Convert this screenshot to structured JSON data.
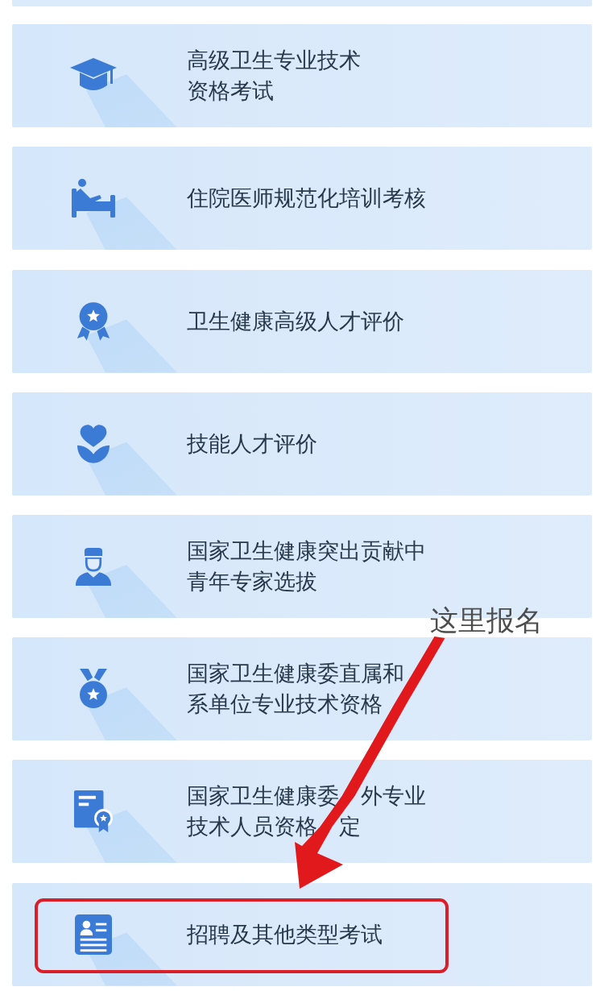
{
  "menu_items": [
    {
      "lines": [
        [
          "高级卫生专业技术"
        ],
        [
          "资格考试"
        ]
      ],
      "highlighted": false
    },
    {
      "lines": [
        [
          "住院医师规范化培训考核"
        ]
      ],
      "highlighted": false
    },
    {
      "lines": [
        [
          "卫生健康高级人才评价"
        ]
      ],
      "highlighted": false
    },
    {
      "lines": [
        [
          "技能人才评价"
        ]
      ],
      "highlighted": false
    },
    {
      "lines": [
        [
          "国家卫生健康突出贡献中"
        ],
        [
          "青年专家选拔"
        ]
      ],
      "highlighted": false
    },
    {
      "lines": [
        [
          "国家卫生健康委直属和"
        ],
        [
          "系单位专业技术资格"
        ]
      ],
      "highlighted": false
    },
    {
      "lines": [
        [
          "国家卫生健康委",
          "外专业"
        ],
        [
          "技术人员资格",
          "定"
        ]
      ],
      "highlighted": false
    },
    {
      "lines": [
        [
          "招聘及其他类型考试"
        ]
      ],
      "highlighted": true
    }
  ],
  "annotation": {
    "label": "这里报名"
  }
}
